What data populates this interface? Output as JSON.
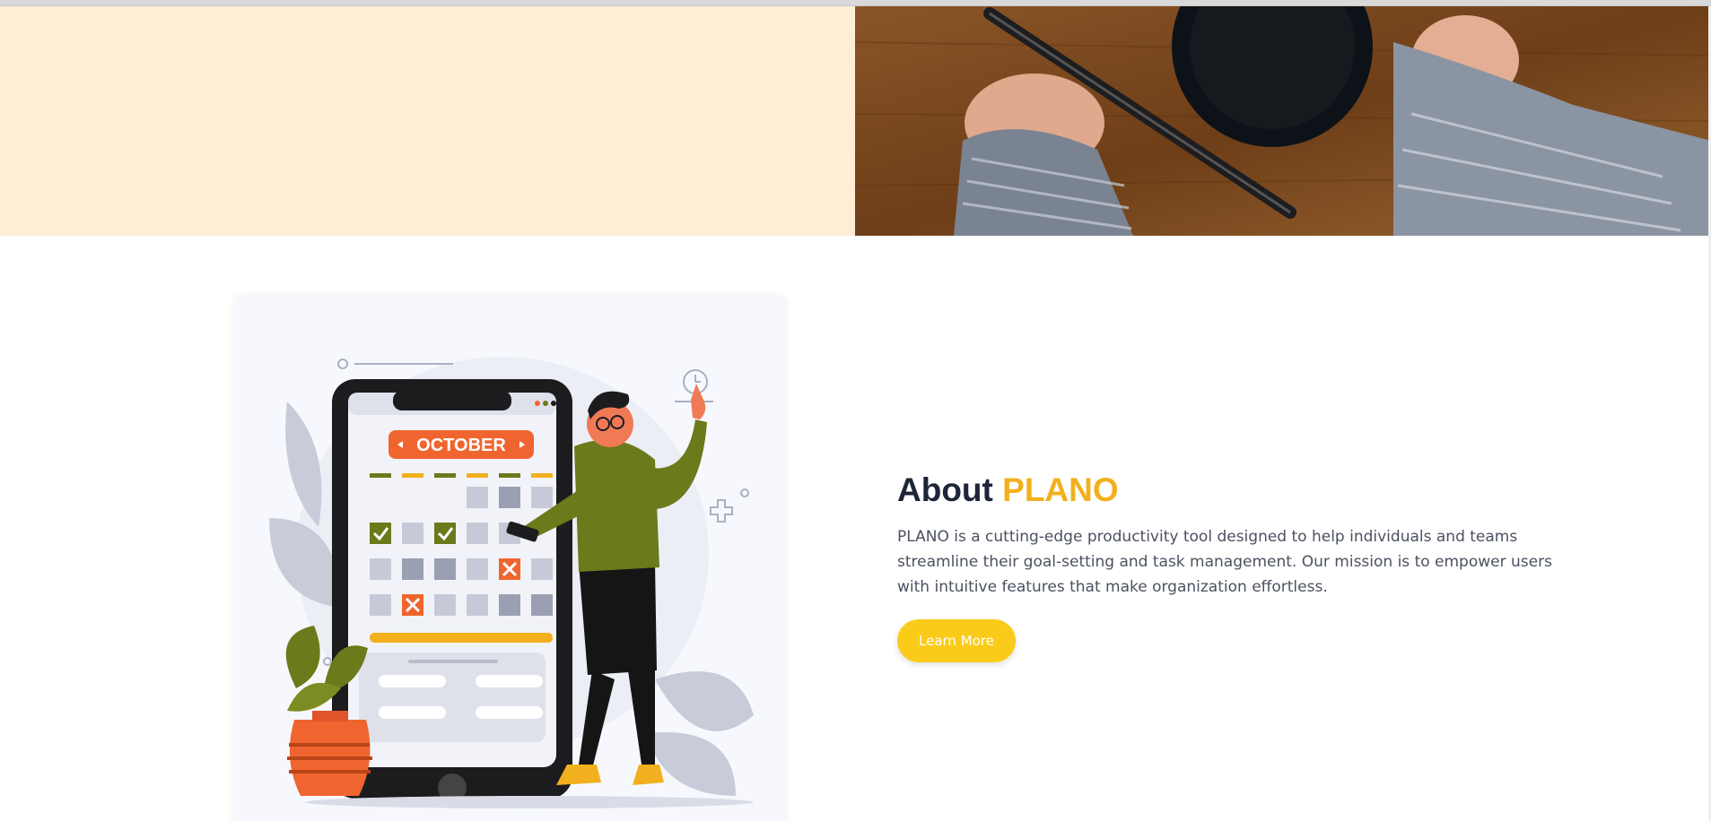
{
  "about": {
    "title_prefix": "About",
    "title_brand": "PLANO",
    "description": "PLANO is a cutting-edge productivity tool designed to help individuals and teams streamline their goal-setting and task management. Our mission is to empower users with intuitive features that make organization effortless.",
    "cta_label": "Learn More"
  },
  "illustration": {
    "calendar_month": "OCTOBER"
  },
  "colors": {
    "accent": "#f2b01e",
    "button": "#fbcb1a",
    "hero_background": "#ffedd6",
    "heading": "#1e2538",
    "olive": "#6b7a1a",
    "orange": "#f0652f"
  }
}
